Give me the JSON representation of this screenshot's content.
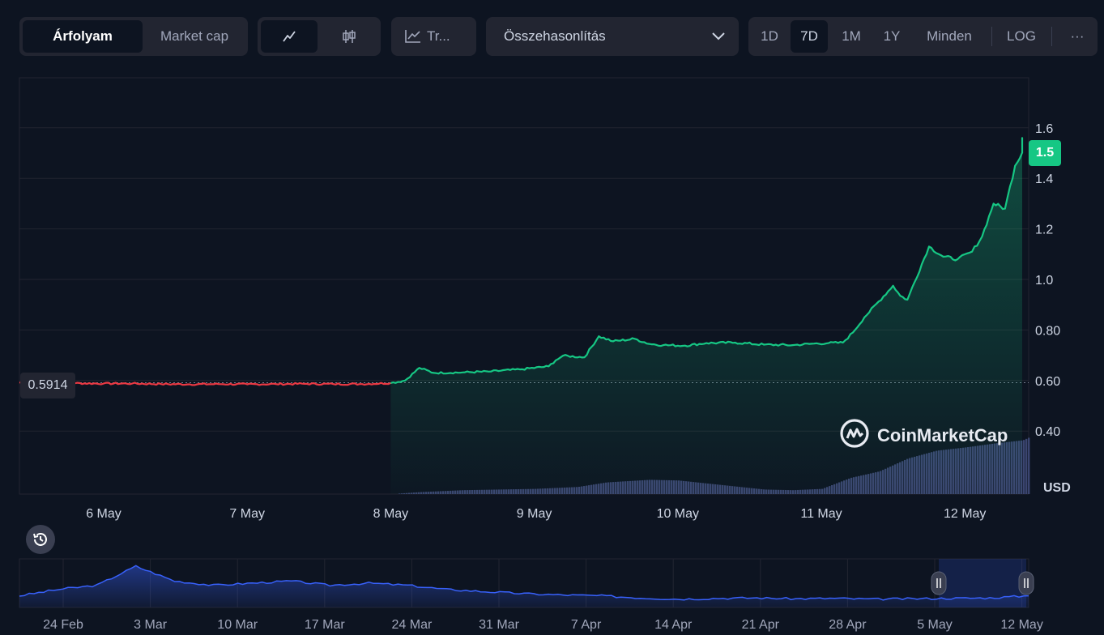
{
  "toolbar": {
    "view_tabs": [
      "Árfolyam",
      "Market cap"
    ],
    "active_view": "Árfolyam",
    "chart_type_icons": [
      "line-chart-icon",
      "candlestick-icon"
    ],
    "tradingview_label": "Tr...",
    "compare_label": "Összehasonlítás",
    "range_options": [
      "1D",
      "7D",
      "1M",
      "1Y",
      "Minden"
    ],
    "active_range": "7D",
    "log_label": "LOG",
    "more_label": "···"
  },
  "colors": {
    "background": "#0d1421",
    "up": "#16c784",
    "down": "#ea3943",
    "volume": "#3b4570",
    "navigator": "#3861fb"
  },
  "price_tag": "1.5",
  "start_price_tag": "0.5914",
  "currency": "USD",
  "watermark": "CoinMarketCap",
  "chart_data": {
    "type": "line",
    "currency": "USD",
    "start_price": 0.5914,
    "current_price": 1.5,
    "x_tick_labels": [
      "6 May",
      "7 May",
      "8 May",
      "9 May",
      "10 May",
      "11 May",
      "12 May"
    ],
    "y_tick_labels": [
      "0.40",
      "0.60",
      "0.80",
      "1.0",
      "1.2",
      "1.4",
      "1.6"
    ],
    "ylim": [
      0.35,
      1.8
    ],
    "grid": true,
    "series": [
      {
        "values": {
          "x_days": [
            5.4,
            5.6,
            5.8,
            6.0,
            6.2,
            6.4,
            6.6,
            6.8,
            7.0,
            7.2,
            7.4,
            7.6,
            7.8,
            8.0,
            8.1,
            8.2,
            8.3,
            8.5,
            8.7,
            8.9,
            9.1,
            9.15,
            9.2,
            9.35,
            9.45,
            9.55,
            9.7,
            9.8,
            9.9,
            10.05,
            10.2,
            10.4,
            10.6,
            10.8,
            10.95,
            11.05,
            11.15,
            11.22,
            11.3,
            11.5,
            11.55,
            11.6,
            11.75,
            11.85,
            11.95,
            12.05,
            12.12,
            12.2,
            12.28,
            12.35,
            12.45,
            12.52
          ],
          "price": [
            0.592,
            0.592,
            0.589,
            0.588,
            0.588,
            0.586,
            0.585,
            0.586,
            0.585,
            0.586,
            0.587,
            0.586,
            0.586,
            0.59,
            0.6,
            0.65,
            0.63,
            0.632,
            0.636,
            0.644,
            0.656,
            0.68,
            0.698,
            0.692,
            0.775,
            0.755,
            0.765,
            0.745,
            0.74,
            0.738,
            0.748,
            0.75,
            0.742,
            0.74,
            0.746,
            0.748,
            0.75,
            0.79,
            0.85,
            0.975,
            0.935,
            0.92,
            1.13,
            1.09,
            1.08,
            1.11,
            1.17,
            1.3,
            1.28,
            1.45,
            1.56,
            1.5
          ]
        },
        "color": "#16c784"
      }
    ],
    "volume_profile": {
      "x_days": [
        5.4,
        8.0,
        8.2,
        8.5,
        9.0,
        9.3,
        9.5,
        9.8,
        10.0,
        10.3,
        10.6,
        10.8,
        11.0,
        11.2,
        11.4,
        11.6,
        11.8,
        12.0,
        12.2,
        12.4,
        12.52
      ],
      "relative": [
        0.0,
        0.0,
        0.03,
        0.06,
        0.08,
        0.11,
        0.18,
        0.22,
        0.21,
        0.14,
        0.07,
        0.06,
        0.08,
        0.25,
        0.35,
        0.55,
        0.67,
        0.72,
        0.78,
        0.83,
        0.95
      ]
    },
    "navigator": {
      "x_tick_labels": [
        "24 Feb",
        "3 Mar",
        "10 Mar",
        "17 Mar",
        "24 Mar",
        "31 Mar",
        "7 Apr",
        "14 Apr",
        "21 Apr",
        "28 Apr",
        "5 May",
        "12 May"
      ],
      "price_relative": [
        0.2,
        0.35,
        0.45,
        0.9,
        0.55,
        0.45,
        0.5,
        0.55,
        0.45,
        0.5,
        0.45,
        0.35,
        0.3,
        0.25,
        0.22,
        0.2,
        0.15,
        0.12,
        0.14,
        0.15,
        0.13,
        0.14,
        0.12,
        0.13,
        0.14,
        0.15,
        0.2
      ]
    }
  }
}
